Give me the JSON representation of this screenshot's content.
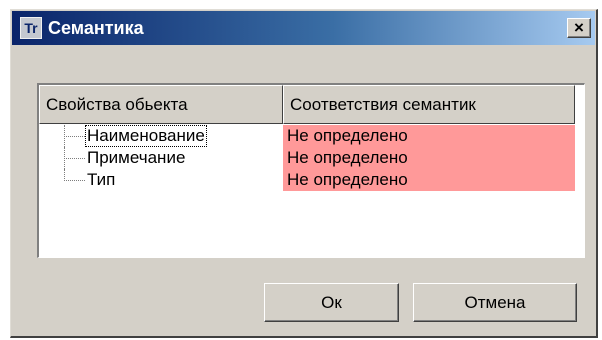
{
  "window": {
    "icon_text": "Tr",
    "title": "Семантика",
    "close_glyph": "×"
  },
  "table": {
    "columns": [
      "Свойства обьекта",
      "Соответствия семантик"
    ],
    "rows": [
      {
        "name": "Наименование",
        "value": "Не определено"
      },
      {
        "name": "Примечание",
        "value": "Не определено"
      },
      {
        "name": "Тип",
        "value": "Не определено"
      }
    ],
    "unmatched_color": "#ff9999"
  },
  "buttons": {
    "ok": "Ок",
    "cancel": "Отмена"
  },
  "colors": {
    "title_gradient_start": "#0a246a",
    "title_gradient_end": "#a6caf0",
    "dialog_face": "#d4d0c8"
  }
}
